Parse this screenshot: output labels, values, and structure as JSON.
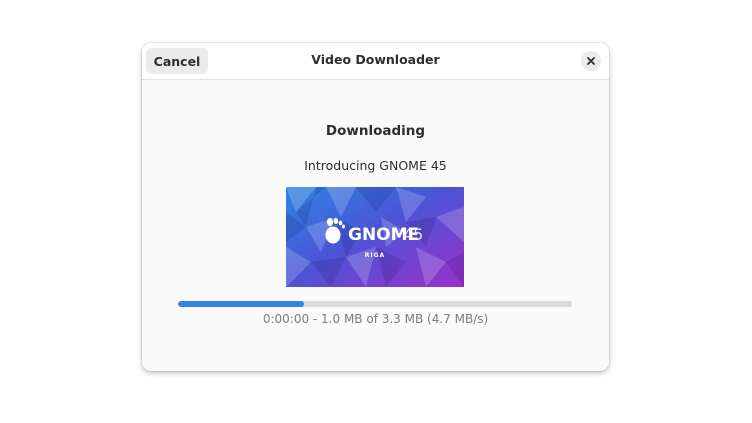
{
  "dialog": {
    "title": "Video Downloader",
    "cancel_label": "Cancel",
    "close_icon": "close-icon"
  },
  "content": {
    "status_title": "Downloading",
    "video_title": "Introducing GNOME 45",
    "thumbnail": {
      "logo_text": "GNOME",
      "version": "45",
      "location": "RIGA"
    },
    "progress": {
      "fraction": 0.32,
      "text": "0:00:00 - 1.0 MB of 3.3 MB (4.7 MB/s)"
    }
  },
  "colors": {
    "accent": "#3584e4",
    "thumbnail_gradient_start": "#2f7fe0",
    "thumbnail_gradient_end": "#9a2fc9"
  }
}
